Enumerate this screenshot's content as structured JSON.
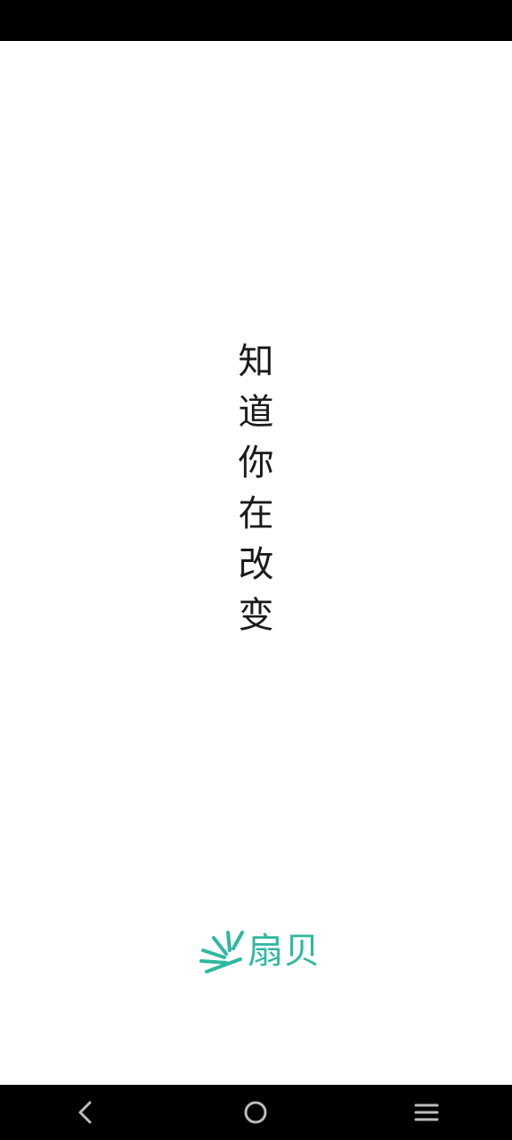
{
  "slogan": {
    "chars": [
      "知",
      "道",
      "你",
      "在",
      "改",
      "变"
    ]
  },
  "brand": {
    "name": "扇贝",
    "icon": "fan-rays-logo-icon",
    "color": "#2fb8a0"
  },
  "navigation": {
    "back_icon": "back-chevron-icon",
    "home_icon": "home-circle-icon",
    "menu_icon": "menu-lines-icon"
  },
  "colors": {
    "background": "#ffffff",
    "status_bar": "#000000",
    "nav_bar": "#000000",
    "text": "#1a1a1a",
    "nav_icon": "#bdbdbd"
  }
}
